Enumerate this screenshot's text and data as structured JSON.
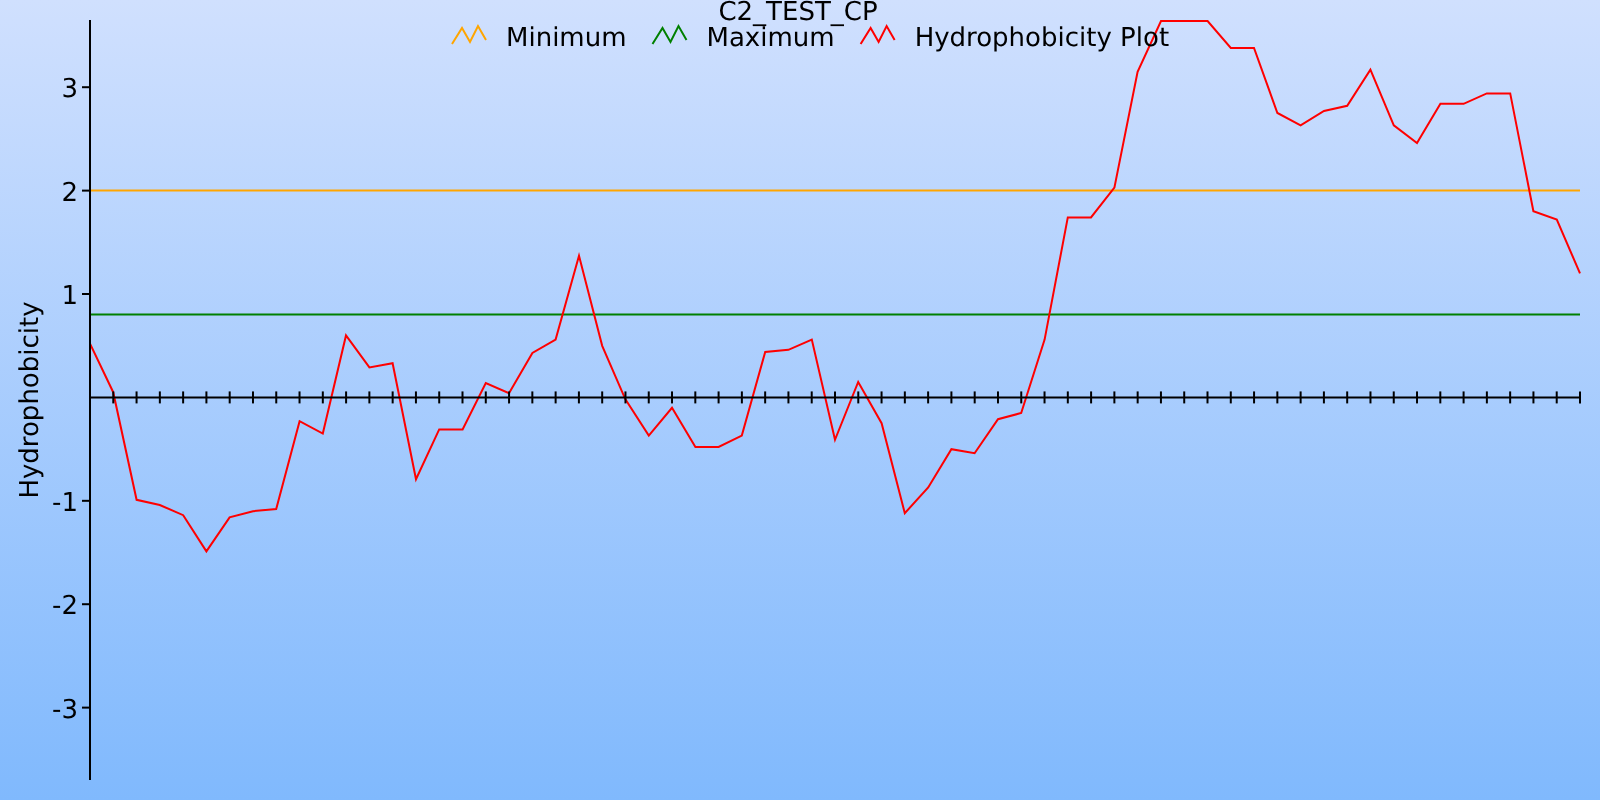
{
  "chart_data": {
    "type": "line",
    "title": "C2_TEST_CP",
    "ylabel": "Hydrophobicity",
    "categories": [
      null,
      null,
      null,
      null,
      null,
      null,
      null,
      null,
      null,
      null,
      null,
      null,
      null,
      null,
      null,
      null,
      null,
      null,
      null,
      null,
      null,
      null,
      null,
      null,
      null,
      null,
      null,
      null,
      null,
      null,
      null,
      null,
      null,
      null,
      null,
      null,
      null,
      null,
      null,
      null,
      null,
      null,
      null,
      null,
      null,
      null,
      null,
      null,
      null,
      null,
      null,
      null,
      null,
      null,
      null,
      null,
      null,
      null,
      null,
      null,
      null,
      null,
      null,
      null,
      null
    ],
    "ylim": [
      -3.7,
      3.65
    ],
    "legend": "top",
    "yticks": [
      {
        "value": -3,
        "label": "-3"
      },
      {
        "value": -2,
        "label": "-2"
      },
      {
        "value": -1,
        "label": "-1"
      },
      {
        "value": 1,
        "label": "1"
      },
      {
        "value": 2,
        "label": "2"
      },
      {
        "value": 3,
        "label": "3"
      }
    ],
    "series": [
      {
        "name": "Minimum",
        "color": "#ffa500",
        "values": [
          2,
          2,
          2,
          2,
          2,
          2,
          2,
          2,
          2,
          2,
          2,
          2,
          2,
          2,
          2,
          2,
          2,
          2,
          2,
          2,
          2,
          2,
          2,
          2,
          2,
          2,
          2,
          2,
          2,
          2,
          2,
          2,
          2,
          2,
          2,
          2,
          2,
          2,
          2,
          2,
          2,
          2,
          2,
          2,
          2,
          2,
          2,
          2,
          2,
          2,
          2,
          2,
          2,
          2,
          2,
          2,
          2,
          2,
          2,
          2,
          2,
          2,
          2,
          2,
          2
        ]
      },
      {
        "name": "Maximum",
        "color": "#008000",
        "values": [
          0.8,
          0.8,
          0.8,
          0.8,
          0.8,
          0.8,
          0.8,
          0.8,
          0.8,
          0.8,
          0.8,
          0.8,
          0.8,
          0.8,
          0.8,
          0.8,
          0.8,
          0.8,
          0.8,
          0.8,
          0.8,
          0.8,
          0.8,
          0.8,
          0.8,
          0.8,
          0.8,
          0.8,
          0.8,
          0.8,
          0.8,
          0.8,
          0.8,
          0.8,
          0.8,
          0.8,
          0.8,
          0.8,
          0.8,
          0.8,
          0.8,
          0.8,
          0.8,
          0.8,
          0.8,
          0.8,
          0.8,
          0.8,
          0.8,
          0.8,
          0.8,
          0.8,
          0.8,
          0.8,
          0.8,
          0.8,
          0.8,
          0.8,
          0.8,
          0.8,
          0.8,
          0.8,
          0.8,
          0.8,
          0.8
        ]
      },
      {
        "name": "Hydrophobicity Plot",
        "color": "#ff0000",
        "values": [
          0.52,
          0.05,
          -0.99,
          -1.04,
          -1.14,
          -1.49,
          -1.16,
          -1.1,
          -1.08,
          -0.23,
          -0.35,
          0.6,
          0.29,
          0.33,
          -0.79,
          -0.31,
          -0.31,
          0.14,
          0.04,
          0.43,
          0.56,
          1.37,
          0.5,
          -0.02,
          -0.37,
          -0.1,
          -0.48,
          -0.48,
          -0.37,
          0.44,
          0.46,
          0.56,
          -0.41,
          0.15,
          -0.25,
          -1.12,
          -0.87,
          -0.5,
          -0.54,
          -0.21,
          -0.15,
          0.56,
          1.74,
          1.74,
          2.03,
          3.15,
          3.64,
          3.64,
          3.64,
          3.38,
          3.38,
          2.75,
          2.63,
          2.77,
          2.82,
          3.17,
          2.63,
          2.46,
          2.84,
          2.84,
          2.94,
          2.94,
          1.8,
          1.72,
          1.2
        ]
      }
    ]
  }
}
